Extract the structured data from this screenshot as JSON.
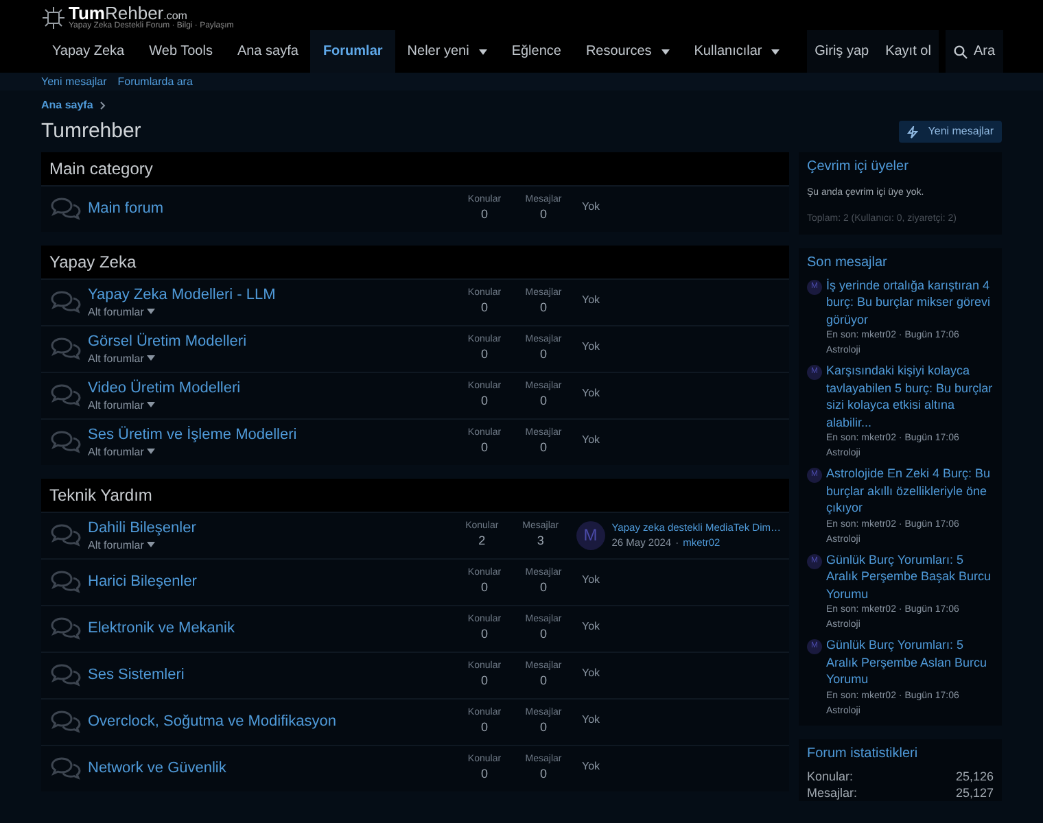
{
  "logo": {
    "strong": "Tum",
    "rest": "Rehber",
    "suffix": ".com",
    "tagline": "Yapay Zeka Destekli Forum · Bilgi · Paylaşım"
  },
  "nav": [
    {
      "label": "Yapay Zeka",
      "selected": false,
      "has_menu": false
    },
    {
      "label": "Web Tools",
      "selected": false,
      "has_menu": false
    },
    {
      "label": "Ana sayfa",
      "selected": false,
      "has_menu": false
    },
    {
      "label": "Forumlar",
      "selected": true,
      "has_menu": false
    },
    {
      "label": "Neler yeni",
      "selected": false,
      "has_menu": true
    },
    {
      "label": "Eğlence",
      "selected": false,
      "has_menu": false
    },
    {
      "label": "Resources",
      "selected": false,
      "has_menu": true
    },
    {
      "label": "Kullanıcılar",
      "selected": false,
      "has_menu": true
    }
  ],
  "account": [
    "Giriş yap",
    "Kayıt ol"
  ],
  "search": "Ara",
  "subnav": [
    "Yeni mesajlar",
    "Forumlarda ara"
  ],
  "breadcrumb": [
    "Ana sayfa"
  ],
  "page_title": "Tumrehber",
  "new_posts_button": "Yeni mesajlar",
  "categories": [
    {
      "title": "Main category",
      "forums": [
        {
          "name": "Main forum",
          "konular_label": "Konular",
          "konular": "0",
          "mesajlar_label": "Mesajlar",
          "mesajlar": "0",
          "last": {
            "kind": "none",
            "text": "Yok"
          }
        }
      ]
    },
    {
      "title": "Yapay Zeka",
      "forums": [
        {
          "name": "Yapay Zeka Modelleri - LLM",
          "subforums": "Alt forumlar",
          "konular_label": "Konular",
          "konular": "0",
          "mesajlar_label": "Mesajlar",
          "mesajlar": "0",
          "last": {
            "kind": "none",
            "text": "Yok"
          }
        },
        {
          "name": "Görsel Üretim Modelleri",
          "subforums": "Alt forumlar",
          "konular_label": "Konular",
          "konular": "0",
          "mesajlar_label": "Mesajlar",
          "mesajlar": "0",
          "last": {
            "kind": "none",
            "text": "Yok"
          }
        },
        {
          "name": "Video Üretim Modelleri",
          "subforums": "Alt forumlar",
          "konular_label": "Konular",
          "konular": "0",
          "mesajlar_label": "Mesajlar",
          "mesajlar": "0",
          "last": {
            "kind": "none",
            "text": "Yok"
          }
        },
        {
          "name": "Ses Üretim ve İşleme Modelleri",
          "subforums": "Alt forumlar",
          "konular_label": "Konular",
          "konular": "0",
          "mesajlar_label": "Mesajlar",
          "mesajlar": "0",
          "last": {
            "kind": "none",
            "text": "Yok"
          }
        }
      ]
    },
    {
      "title": "Teknik Yardım",
      "forums": [
        {
          "name": "Dahili Bileşenler",
          "subforums": "Alt forumlar",
          "konular_label": "Konular",
          "konular": "2",
          "mesajlar_label": "Mesajlar",
          "mesajlar": "3",
          "last": {
            "kind": "post",
            "avatar": "M",
            "title": "Yapay zeka destekli MediaTek Dim…",
            "date": "26 May 2024",
            "separator": "·",
            "user": "mketr02"
          }
        },
        {
          "name": "Harici Bileşenler",
          "konular_label": "Konular",
          "konular": "0",
          "mesajlar_label": "Mesajlar",
          "mesajlar": "0",
          "last": {
            "kind": "none",
            "text": "Yok"
          }
        },
        {
          "name": "Elektronik ve Mekanik",
          "konular_label": "Konular",
          "konular": "0",
          "mesajlar_label": "Mesajlar",
          "mesajlar": "0",
          "last": {
            "kind": "none",
            "text": "Yok"
          }
        },
        {
          "name": "Ses Sistemleri",
          "konular_label": "Konular",
          "konular": "0",
          "mesajlar_label": "Mesajlar",
          "mesajlar": "0",
          "last": {
            "kind": "none",
            "text": "Yok"
          }
        },
        {
          "name": "Overclock, Soğutma ve Modifikasyon",
          "konular_label": "Konular",
          "konular": "0",
          "mesajlar_label": "Mesajlar",
          "mesajlar": "0",
          "last": {
            "kind": "none",
            "text": "Yok"
          }
        },
        {
          "name": "Network ve Güvenlik",
          "konular_label": "Konular",
          "konular": "0",
          "mesajlar_label": "Mesajlar",
          "mesajlar": "0",
          "last": {
            "kind": "none",
            "text": "Yok"
          }
        }
      ]
    }
  ],
  "online": {
    "title": "Çevrim içi üyeler",
    "text": "Şu anda çevrim içi üye yok.",
    "total": "Toplam: 2 (Kullanıcı: 0, ziyaretçi: 2)"
  },
  "latest": {
    "title": "Son mesajlar",
    "posts": [
      {
        "avatar": "M",
        "title": "İş yerinde ortalığa karıştıran 4 burç: Bu burçlar mikser görevi görüyor",
        "meta": "En son: mketr02 · Bugün 17:06",
        "forum": "Astroloji"
      },
      {
        "avatar": "M",
        "title": "Karşısındaki kişiyi kolayca tavlayabilen 5 burç: Bu burçlar sizi kolayca etkisi altına alabilir...",
        "meta": "En son: mketr02 · Bugün 17:06",
        "forum": "Astroloji"
      },
      {
        "avatar": "M",
        "title": "Astrolojide En Zeki 4 Burç: Bu burçlar akıllı özellikleriyle öne çıkıyor",
        "meta": "En son: mketr02 · Bugün 17:06",
        "forum": "Astroloji"
      },
      {
        "avatar": "M",
        "title": "Günlük Burç Yorumları: 5 Aralık Perşembe Başak Burcu Yorumu",
        "meta": "En son: mketr02 · Bugün 17:06",
        "forum": "Astroloji"
      },
      {
        "avatar": "M",
        "title": "Günlük Burç Yorumları: 5 Aralık Perşembe Aslan Burcu Yorumu",
        "meta": "En son: mketr02 · Bugün 17:06",
        "forum": "Astroloji"
      }
    ]
  },
  "stats": {
    "title": "Forum istatistikleri",
    "rows": [
      {
        "label": "Konular:",
        "value": "25,126"
      },
      {
        "label": "Mesajlar:",
        "value": "25,127"
      }
    ]
  }
}
